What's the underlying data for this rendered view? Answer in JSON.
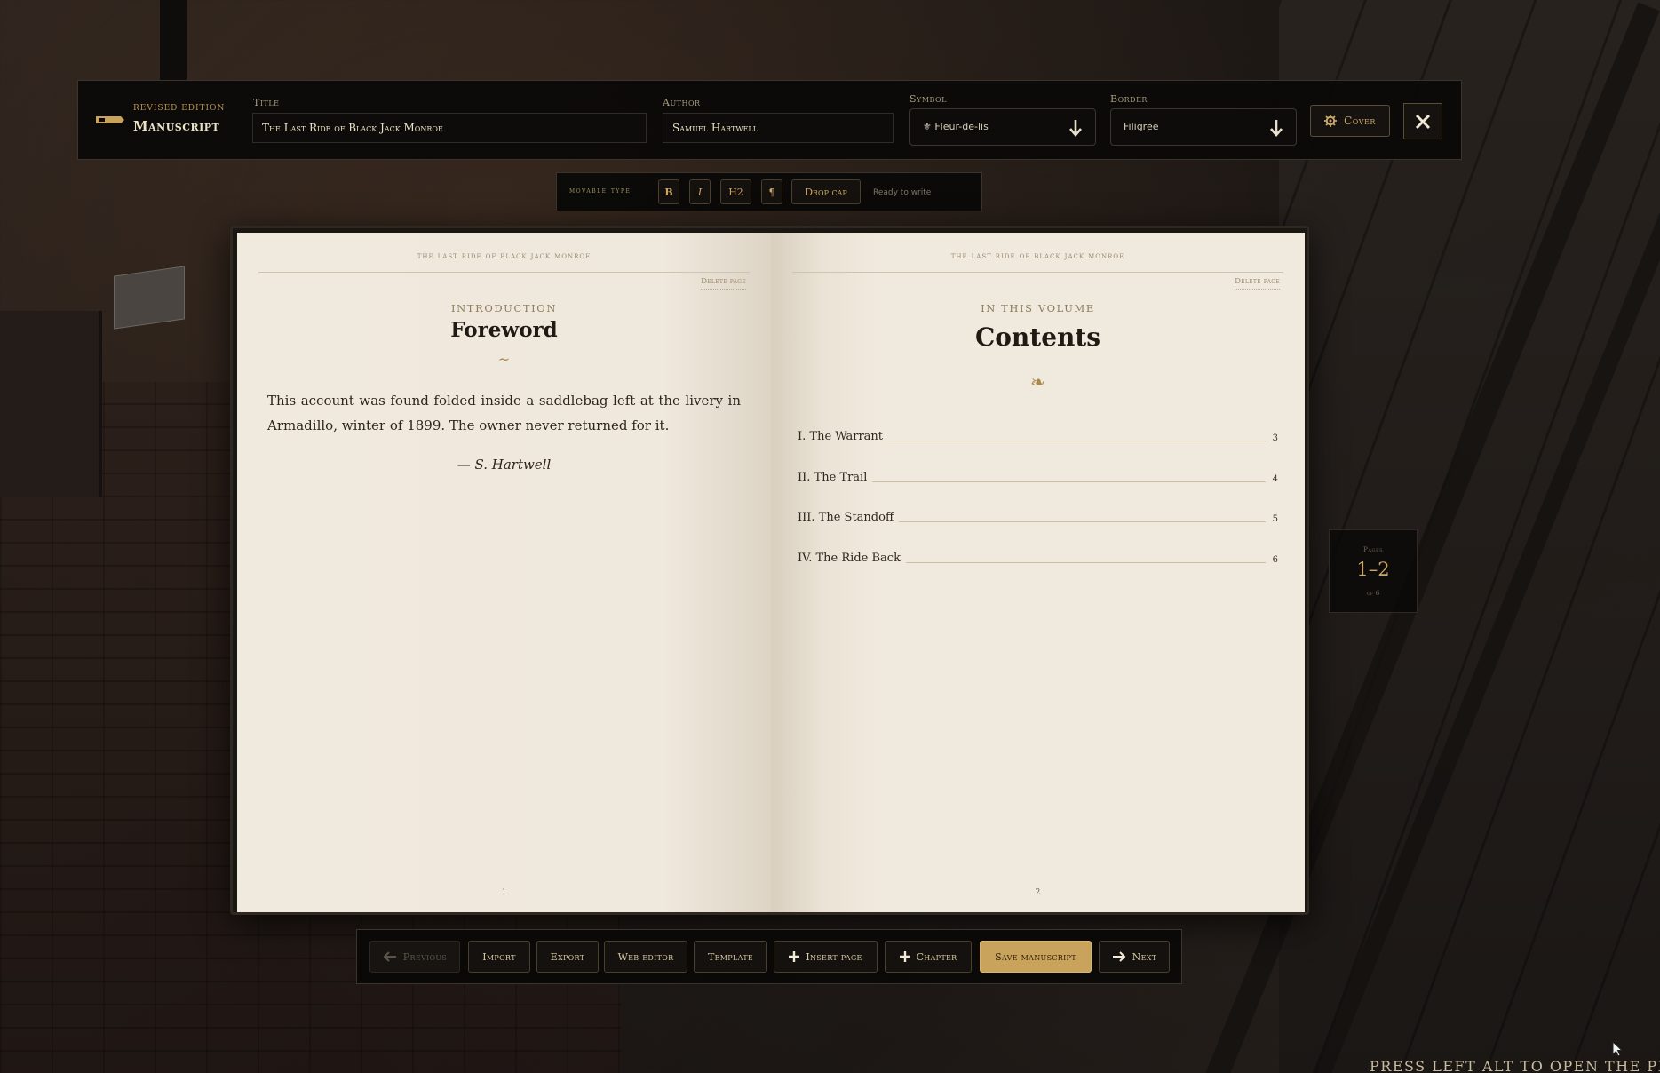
{
  "header": {
    "brand_sub": "Revised edition",
    "brand_title": "Manuscript",
    "title_label": "Title",
    "title_value": "The Last Ride of Black Jack Monroe",
    "author_label": "Author",
    "author_value": "Samuel Hartwell",
    "symbol_label": "Symbol",
    "symbol_value": "⚜ Fleur-de-lis",
    "border_label": "Border",
    "border_value": "Filigree",
    "cover_label": "Cover"
  },
  "typebar": {
    "label": "movable type",
    "bold": "B",
    "italic": "I",
    "h2": "H2",
    "para": "¶",
    "dropcap": "Drop cap",
    "status": "Ready to write"
  },
  "left_page": {
    "running_head": "the last ride of black jack monroe",
    "delete": "Delete page",
    "eyebrow": "INTRODUCTION",
    "heading": "Foreword",
    "ornament": "~",
    "body": "This account was found folded inside a saddlebag left at the livery in Armadillo, winter of 1899. The owner never returned for it.",
    "signature": "— S. Hartwell",
    "folio": "1"
  },
  "right_page": {
    "running_head": "the last ride of black jack monroe",
    "delete": "Delete page",
    "eyebrow": "IN THIS VOLUME",
    "heading": "Contents",
    "ornament": "❧",
    "toc": [
      {
        "title": "I. The Warrant",
        "page": "3"
      },
      {
        "title": "II. The Trail",
        "page": "4"
      },
      {
        "title": "III. The Standoff",
        "page": "5"
      },
      {
        "title": "IV. The Ride Back",
        "page": "6"
      }
    ],
    "folio": "2"
  },
  "pages_indicator": {
    "label": "Pages",
    "range": "1–2",
    "of": "of 6"
  },
  "bottombar": {
    "previous": "Previous",
    "import": "Import",
    "export": "Export",
    "web_editor": "Web editor",
    "template": "Template",
    "insert_page": "Insert page",
    "chapter": "Chapter",
    "save": "Save manuscript",
    "next": "Next"
  },
  "prompt": "PRESS LEFT ALT TO OPEN THE PRI",
  "colors": {
    "accent": "#c9a767",
    "page": "#efe8dc",
    "panel": "#0a0908"
  }
}
